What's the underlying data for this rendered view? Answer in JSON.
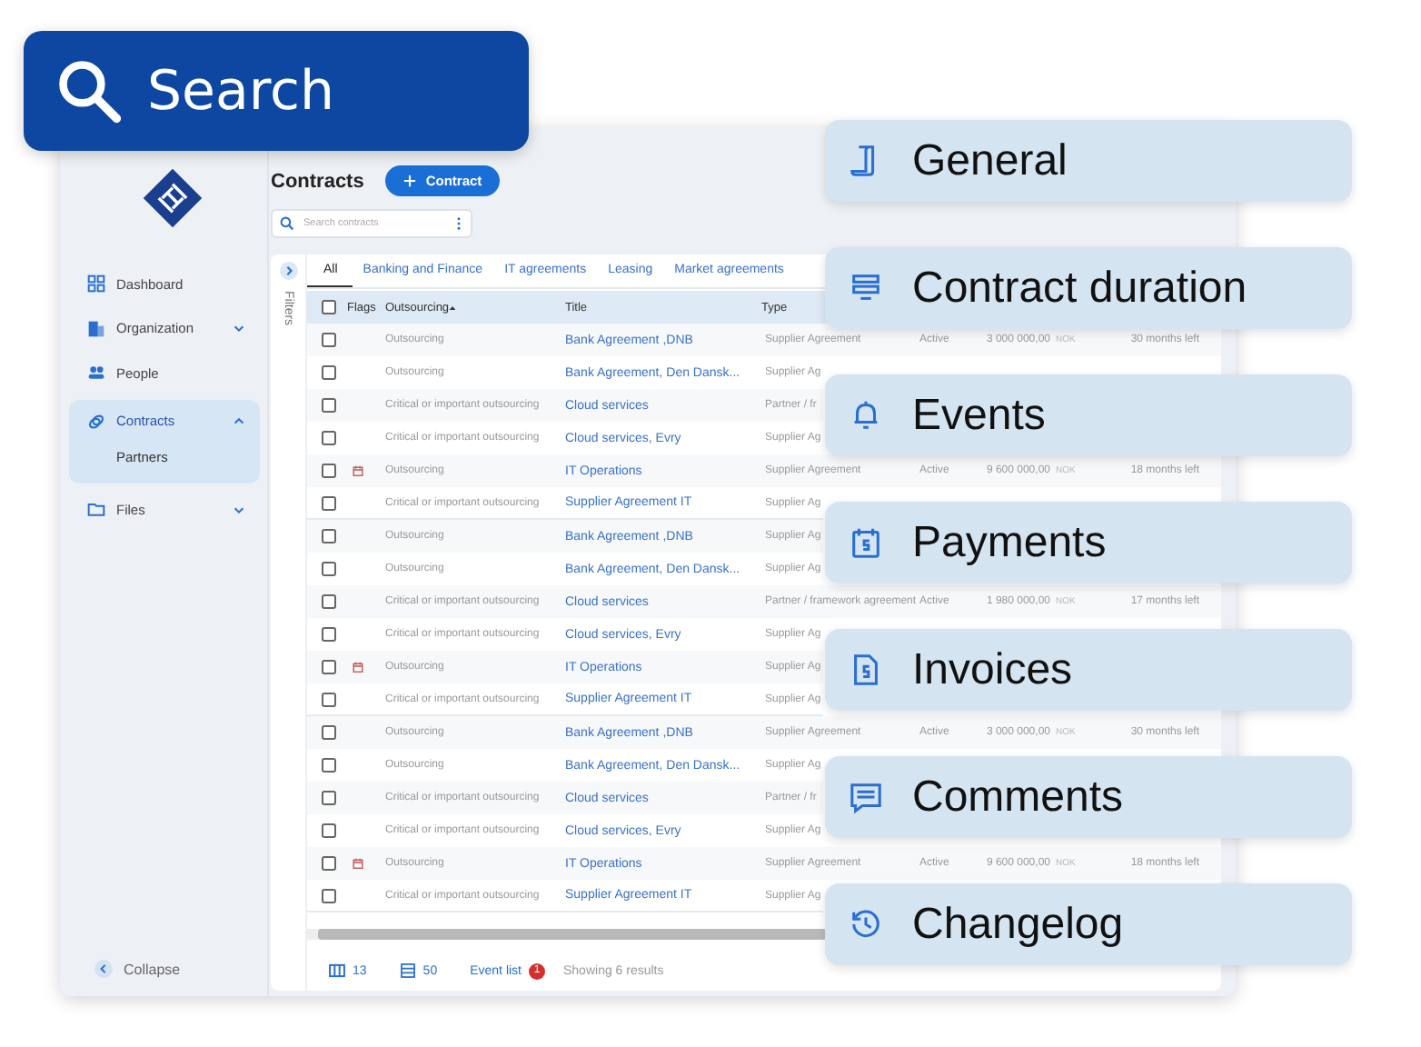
{
  "search_banner": {
    "label": "Search"
  },
  "sidebar": {
    "items": [
      {
        "label": "Dashboard",
        "selected": false
      },
      {
        "label": "Organization",
        "selected": false,
        "expanded": false
      },
      {
        "label": "People",
        "selected": false
      },
      {
        "label": "Contracts",
        "selected": true,
        "expanded": true,
        "children": [
          {
            "label": "Partners"
          }
        ]
      },
      {
        "label": "Files",
        "selected": false,
        "expanded": false
      }
    ],
    "collapse": "Collapse"
  },
  "page": {
    "title": "Contracts",
    "new_button": "Contract",
    "search": {
      "placeholder": "Search contracts"
    }
  },
  "filters": {
    "label": "Filters"
  },
  "tabs": [
    {
      "label": "All",
      "selected": true
    },
    {
      "label": "Banking and Finance",
      "selected": false
    },
    {
      "label": "IT agreements",
      "selected": false
    },
    {
      "label": "Leasing",
      "selected": false
    },
    {
      "label": "Market agreements",
      "selected": false
    }
  ],
  "table": {
    "checked": false,
    "columns": [
      "Flags",
      "Outsourcing",
      "Title",
      "Type"
    ],
    "rows": [
      {
        "checked": false,
        "flag": false,
        "outsourcing": "Outsourcing",
        "title": "Bank Agreement ,DNB",
        "type": "Supplier Agreement",
        "status": "Active",
        "amount": "3 000 000,00",
        "currency": "NOK",
        "remaining": "30 months left"
      },
      {
        "checked": false,
        "flag": false,
        "outsourcing": "Outsourcing",
        "title": "Bank Agreement, Den Dansk...",
        "type": "Supplier Ag"
      },
      {
        "checked": false,
        "flag": false,
        "outsourcing": "Critical or important outsourcing",
        "title": "Cloud services",
        "type": "Partner / fr"
      },
      {
        "checked": false,
        "flag": false,
        "outsourcing": "Critical or important outsourcing",
        "title": "Cloud services, Evry",
        "type": "Supplier Ag"
      },
      {
        "checked": false,
        "flag": true,
        "outsourcing": "Outsourcing",
        "title": "IT Operations",
        "type": "Supplier Agreement",
        "status": "Active",
        "amount": "9 600 000,00",
        "currency": "NOK",
        "remaining": "18 months left"
      },
      {
        "checked": false,
        "flag": false,
        "outsourcing": "Critical or important outsourcing",
        "title": "Supplier Agreement IT",
        "type": "Supplier Ag"
      },
      {
        "checked": false,
        "flag": false,
        "outsourcing": "Outsourcing",
        "title": "Bank Agreement ,DNB",
        "type": "Supplier Ag"
      },
      {
        "checked": false,
        "flag": false,
        "outsourcing": "Outsourcing",
        "title": "Bank Agreement, Den Dansk...",
        "type": "Supplier Ag"
      },
      {
        "checked": false,
        "flag": false,
        "outsourcing": "Critical or important outsourcing",
        "title": "Cloud services",
        "type": "Partner / framework agreement",
        "status": "Active",
        "amount": "1 980 000,00",
        "currency": "NOK",
        "remaining": "17 months left"
      },
      {
        "checked": false,
        "flag": false,
        "outsourcing": "Critical or important outsourcing",
        "title": "Cloud services, Evry",
        "type": "Supplier Ag"
      },
      {
        "checked": false,
        "flag": true,
        "outsourcing": "Outsourcing",
        "title": "IT Operations",
        "type": "Supplier Ag"
      },
      {
        "checked": false,
        "flag": false,
        "outsourcing": "Critical or important outsourcing",
        "title": "Supplier Agreement IT",
        "type": "Supplier Ag"
      },
      {
        "checked": false,
        "flag": false,
        "outsourcing": "Outsourcing",
        "title": "Bank Agreement ,DNB",
        "type": "Supplier Agreement",
        "status": "Active",
        "amount": "3 000 000,00",
        "currency": "NOK",
        "remaining": "30 months left"
      },
      {
        "checked": false,
        "flag": false,
        "outsourcing": "Outsourcing",
        "title": "Bank Agreement, Den Dansk...",
        "type": "Supplier Ag"
      },
      {
        "checked": false,
        "flag": false,
        "outsourcing": "Critical or important outsourcing",
        "title": "Cloud services",
        "type": "Partner / fr"
      },
      {
        "checked": false,
        "flag": false,
        "outsourcing": "Critical or important outsourcing",
        "title": "Cloud services, Evry",
        "type": "Supplier Ag"
      },
      {
        "checked": false,
        "flag": true,
        "outsourcing": "Outsourcing",
        "title": "IT Operations",
        "type": "Supplier Agreement",
        "status": "Active",
        "amount": "9 600 000,00",
        "currency": "NOK",
        "remaining": "18 months left"
      },
      {
        "checked": false,
        "flag": false,
        "outsourcing": "Critical or important outsourcing",
        "title": "Supplier Agreement IT",
        "type": "Supplier Ag"
      }
    ]
  },
  "footer": {
    "columns_count": "13",
    "page_size": "50",
    "event_list": "Event list",
    "event_badge": "1",
    "results": "Showing 6 results"
  },
  "features": [
    {
      "label": "General"
    },
    {
      "label": "Contract duration"
    },
    {
      "label": "Events"
    },
    {
      "label": "Payments"
    },
    {
      "label": "Invoices"
    },
    {
      "label": "Comments"
    },
    {
      "label": "Changelog"
    }
  ]
}
